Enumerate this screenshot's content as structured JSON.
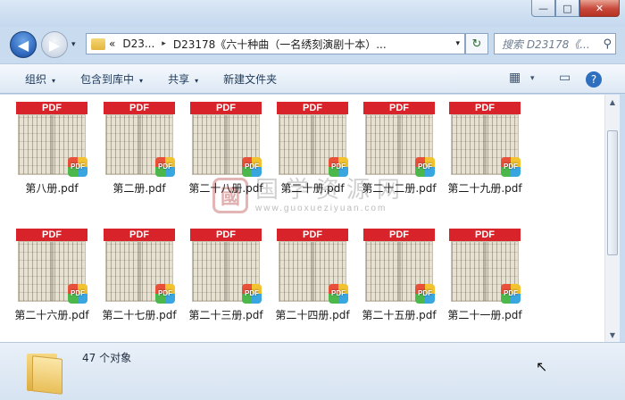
{
  "window": {
    "buttons": {
      "minimize": "—",
      "maximize": "□",
      "close": "✕"
    }
  },
  "nav": {
    "back_icon": "◀",
    "forward_icon": "▶",
    "history_icon": "▾",
    "breadcrumb": {
      "overflow": "«",
      "segments": [
        "D23...",
        "D23178《六十种曲（一名绣刻演剧十本）..."
      ],
      "separator": "▸"
    },
    "refresh_icon": "↻",
    "search_placeholder": "搜索 D23178《...",
    "search_icon": "⚲"
  },
  "toolbar": {
    "items": [
      "组织",
      "包含到库中",
      "共享",
      "新建文件夹"
    ],
    "dropdown_glyph": "▾",
    "view_icon": "▦",
    "pane_icon": "▭",
    "help_icon": "?"
  },
  "watermark": {
    "seal": "國",
    "title": "国学资源网",
    "url": "www.guoxueziyuan.com"
  },
  "files": {
    "thumb_label": "PDF",
    "badge_label": "PDF",
    "items": [
      "第八册.pdf",
      "第二册.pdf",
      "第二十八册.pdf",
      "第二十册.pdf",
      "第二十二册.pdf",
      "第二十九册.pdf",
      "第二十六册.pdf",
      "第二十七册.pdf",
      "第二十三册.pdf",
      "第二十四册.pdf",
      "第二十五册.pdf",
      "第二十一册.pdf"
    ]
  },
  "status": {
    "count_text": "47 个对象"
  },
  "scrollbar": {
    "up": "▲",
    "down": "▼"
  }
}
